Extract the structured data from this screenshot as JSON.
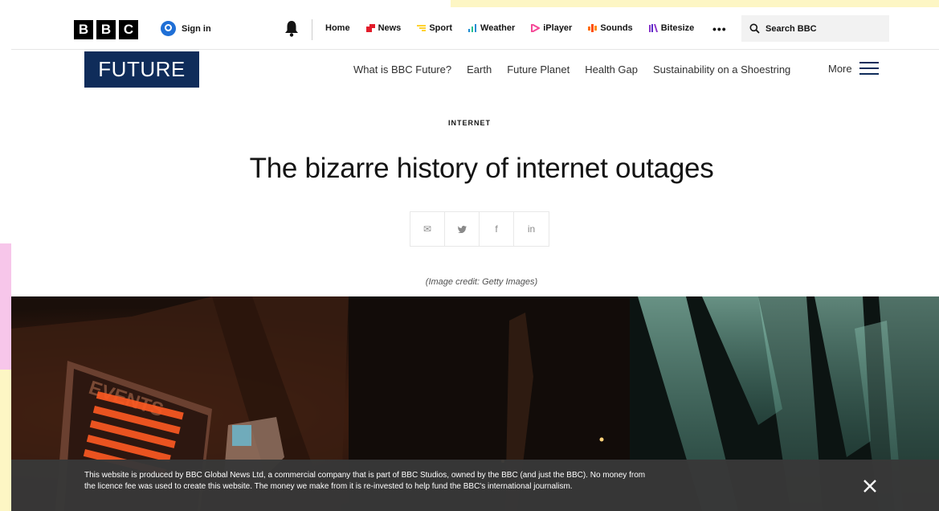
{
  "global_nav": {
    "logo_letters": [
      "B",
      "B",
      "C"
    ],
    "signin_label": "Sign in",
    "links": [
      {
        "label": "Home",
        "icon": "none",
        "color": ""
      },
      {
        "label": "News",
        "icon": "news-icon",
        "color": "#e21c2a"
      },
      {
        "label": "Sport",
        "icon": "sport-icon",
        "color": "#ffd230"
      },
      {
        "label": "Weather",
        "icon": "weather-icon",
        "color": "#1f8bd3"
      },
      {
        "label": "iPlayer",
        "icon": "iplayer-icon",
        "color": "#f54997"
      },
      {
        "label": "Sounds",
        "icon": "sounds-icon",
        "color": "#ff6d00"
      },
      {
        "label": "Bitesize",
        "icon": "bitesize-icon",
        "color": "#8a35c9"
      }
    ],
    "more_label": "•••",
    "search_label": "Search BBC"
  },
  "future": {
    "logo_text": "FUTURE",
    "section_links": [
      "What is BBC Future?",
      "Earth",
      "Future Planet",
      "Health Gap",
      "Sustainability on a Shoestring"
    ],
    "more_label": "More"
  },
  "article": {
    "kicker": "INTERNET",
    "title": "The bizarre history of internet outages",
    "share": [
      {
        "name": "email",
        "glyph": "✉"
      },
      {
        "name": "twitter",
        "glyph": "🐦"
      },
      {
        "name": "facebook",
        "glyph": "f"
      },
      {
        "name": "linkedin",
        "glyph": "in"
      }
    ],
    "image_credit": "(Image credit: Getty Images)",
    "sign_text": "EVENTS"
  },
  "notice": {
    "text": "This website is produced by BBC Global News Ltd, a commercial company that is part of BBC Studios, owned by the BBC (and just the BBC). No money from the licence fee was used to create this website. The money we make from it is re-invested to help fund the BBC's international journalism."
  },
  "colors": {
    "future_navy": "#0f2c5a",
    "banner_bg": "#383838"
  }
}
